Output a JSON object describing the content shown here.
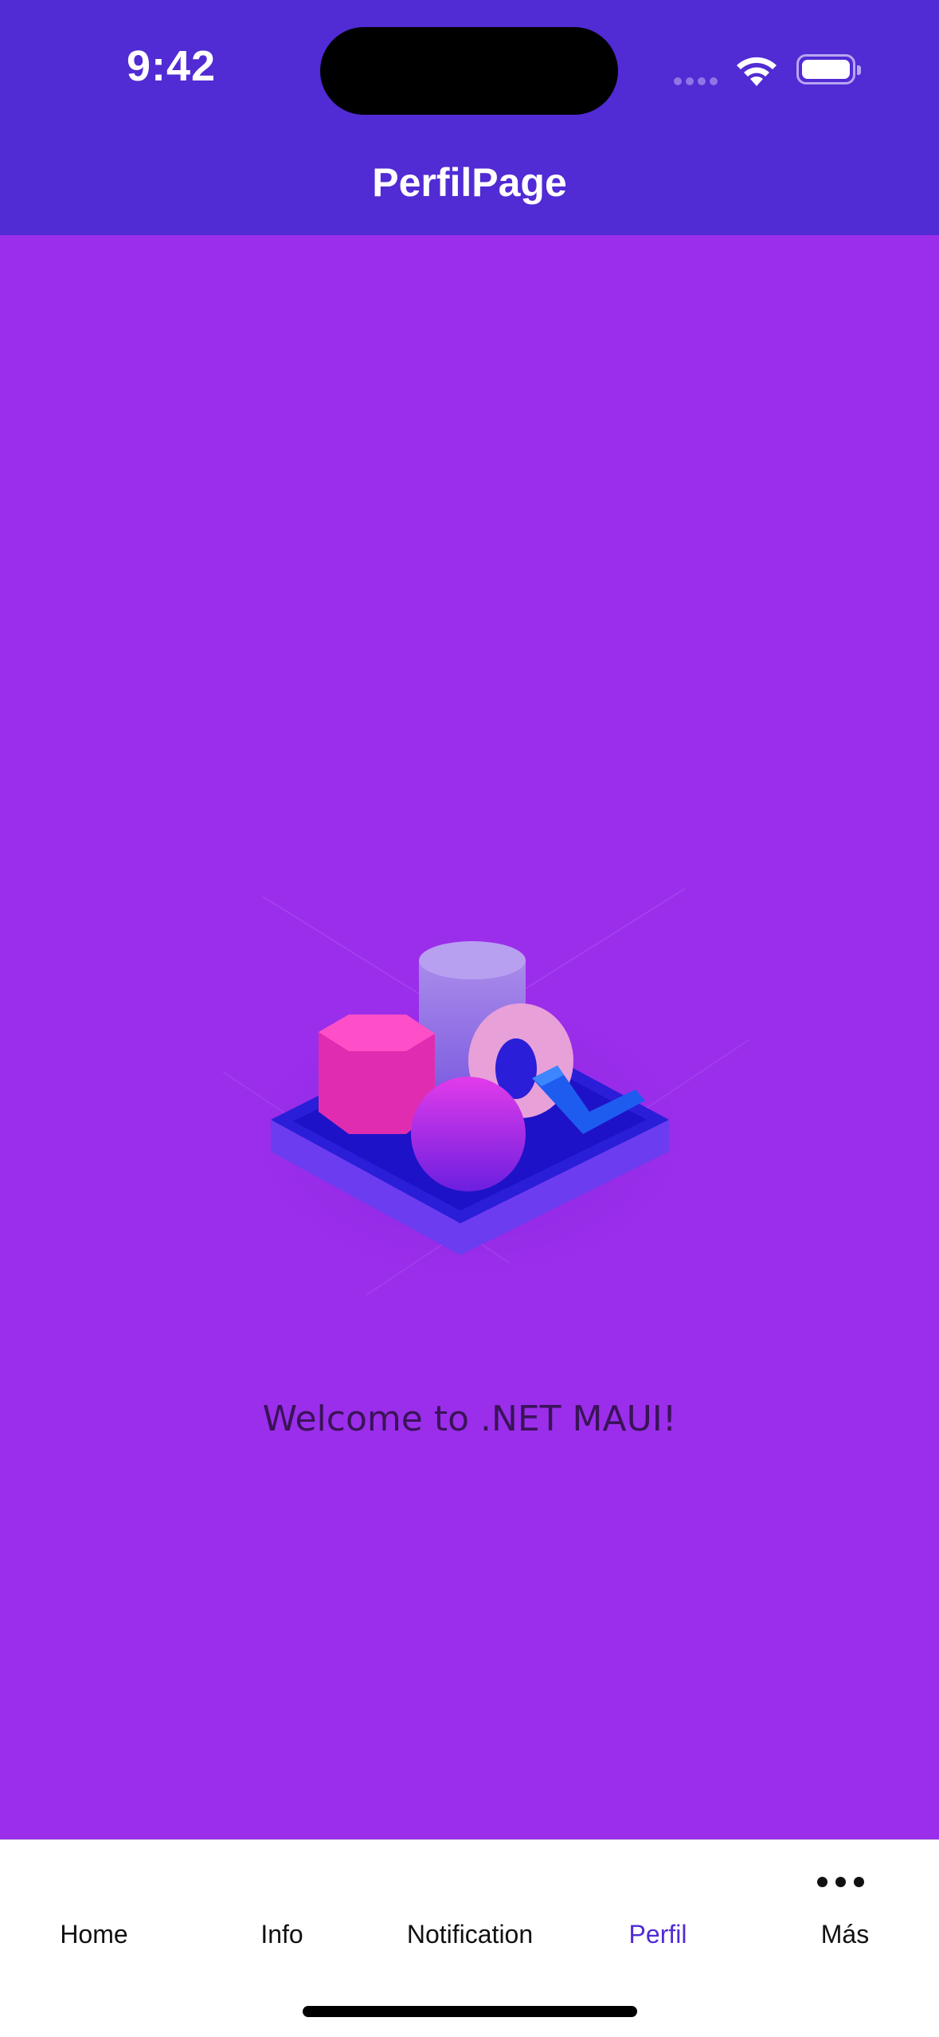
{
  "status_bar": {
    "time": "9:42",
    "icons": [
      "signal-icon",
      "wifi-icon",
      "battery-icon"
    ]
  },
  "nav": {
    "title": "PerfilPage"
  },
  "content": {
    "image": "dotnet-bot-box-illustration",
    "welcome_text": "Welcome to .NET MAUI!"
  },
  "tab_bar": {
    "items": [
      {
        "label": "Home",
        "active": false
      },
      {
        "label": "Info",
        "active": false
      },
      {
        "label": "Notification",
        "active": false
      },
      {
        "label": "Perfil",
        "active": true
      },
      {
        "label": "Más",
        "active": false,
        "icon": "more-icon"
      }
    ]
  },
  "colors": {
    "brand": "#512BD4",
    "page_background": "#9B2EEB",
    "tab_active": "#512BD4",
    "tab_inactive": "#111111"
  }
}
